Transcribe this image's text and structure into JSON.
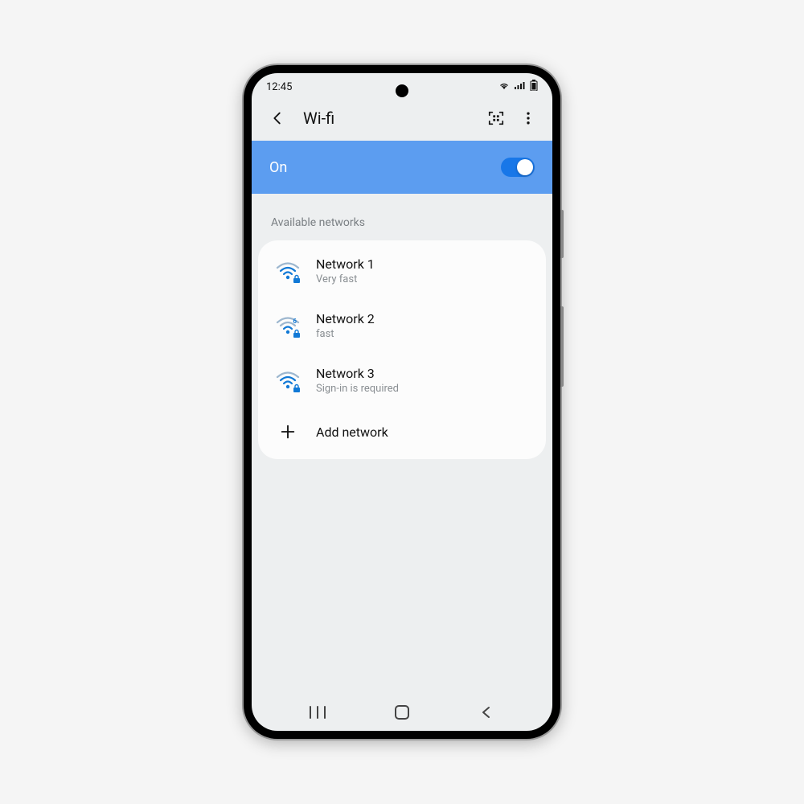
{
  "status": {
    "time": "12:45"
  },
  "header": {
    "title": "Wi-fi"
  },
  "wifi_toggle": {
    "state_label": "On",
    "enabled": true
  },
  "section": {
    "label": "Available networks"
  },
  "networks": [
    {
      "name": "Network 1",
      "status": "Very fast",
      "secured": true,
      "badge": ""
    },
    {
      "name": "Network 2",
      "status": "fast",
      "secured": true,
      "badge": "6"
    },
    {
      "name": "Network 3",
      "status": "Sign-in is required",
      "secured": true,
      "badge": ""
    }
  ],
  "add_network": {
    "label": "Add network"
  },
  "colors": {
    "accent": "#5c9df0",
    "switch_track": "#1877e8",
    "wifi": "#1179d6"
  }
}
